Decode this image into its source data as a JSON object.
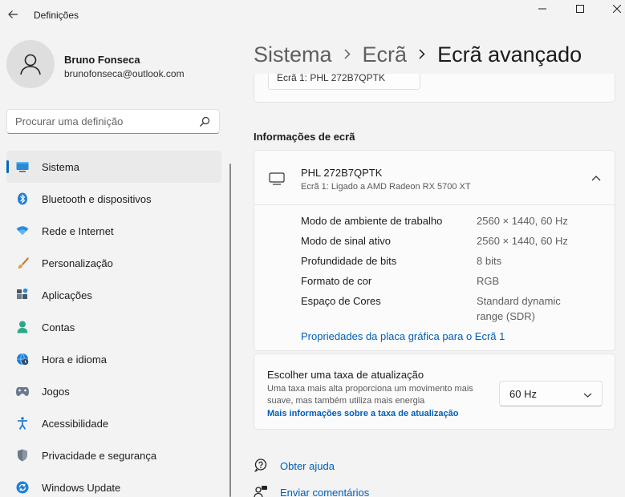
{
  "window": {
    "title": "Definições",
    "back_icon": "arrow-left-icon",
    "controls": [
      "minimize-icon",
      "maximize-icon",
      "close-icon"
    ]
  },
  "profile": {
    "name": "Bruno Fonseca",
    "email": "brunofonseca@outlook.com"
  },
  "search": {
    "placeholder": "Procurar uma definição"
  },
  "sidebar": {
    "items": [
      {
        "label": "Sistema",
        "icon": "monitor-icon",
        "active": true
      },
      {
        "label": "Bluetooth e dispositivos",
        "icon": "bluetooth-icon"
      },
      {
        "label": "Rede e Internet",
        "icon": "wifi-icon"
      },
      {
        "label": "Personalização",
        "icon": "brush-icon"
      },
      {
        "label": "Aplicações",
        "icon": "apps-icon"
      },
      {
        "label": "Contas",
        "icon": "person-icon"
      },
      {
        "label": "Hora e idioma",
        "icon": "globe-clock-icon"
      },
      {
        "label": "Jogos",
        "icon": "gamepad-icon"
      },
      {
        "label": "Acessibilidade",
        "icon": "accessibility-icon"
      },
      {
        "label": "Privacidade e segurança",
        "icon": "shield-icon"
      },
      {
        "label": "Windows Update",
        "icon": "update-icon"
      }
    ]
  },
  "breadcrumb": {
    "items": [
      "Sistema",
      "Ecrã"
    ],
    "current": "Ecrã avançado"
  },
  "top_card": {
    "dropdown_value": "Ecrã 1: PHL 272B7QPTK"
  },
  "display_info": {
    "section_title": "Informações de ecrã",
    "monitor_name": "PHL 272B7QPTK",
    "monitor_subtitle": "Ecrã 1: Ligado a AMD Radeon RX 5700 XT",
    "rows": [
      {
        "label": "Modo de ambiente de trabalho",
        "value": "2560 × 1440, 60 Hz"
      },
      {
        "label": "Modo de sinal ativo",
        "value": "2560 × 1440, 60 Hz"
      },
      {
        "label": "Profundidade de bits",
        "value": "8 bits"
      },
      {
        "label": "Formato de cor",
        "value": "RGB"
      },
      {
        "label": "Espaço de Cores",
        "value": "Standard dynamic range (SDR)"
      }
    ],
    "gpu_link": "Propriedades da placa gráfica para o Ecrã 1"
  },
  "refresh": {
    "title": "Escolher uma taxa de atualização",
    "description": "Uma taxa mais alta proporciona um movimento mais suave, mas também utiliza mais energia",
    "link": "Mais informações sobre a taxa de atualização",
    "selected": "60 Hz"
  },
  "footer": {
    "help": "Obter ajuda",
    "feedback": "Enviar comentários"
  },
  "colors": {
    "accent": "#0067c0",
    "link": "#005fb8",
    "background": "#f3f3f3",
    "card": "#fbfbfb"
  }
}
